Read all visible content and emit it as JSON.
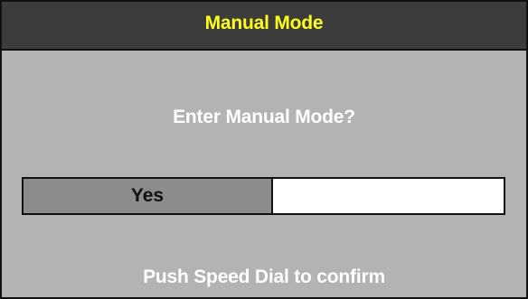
{
  "title_bar": {
    "title": "Manual Mode",
    "title_color": "#ffff1a",
    "background_color": "#3c3c3c"
  },
  "dialog": {
    "question": "Enter Manual Mode?",
    "options": [
      {
        "label": "Yes",
        "selected": true
      },
      {
        "label": "",
        "selected": false
      }
    ],
    "hint": "Push Speed Dial to confirm"
  },
  "colors": {
    "screen_background": "#b3b3b3",
    "selected_option": "#8c8c8c",
    "unselected_option": "#ffffff",
    "text": "#ffffff"
  }
}
